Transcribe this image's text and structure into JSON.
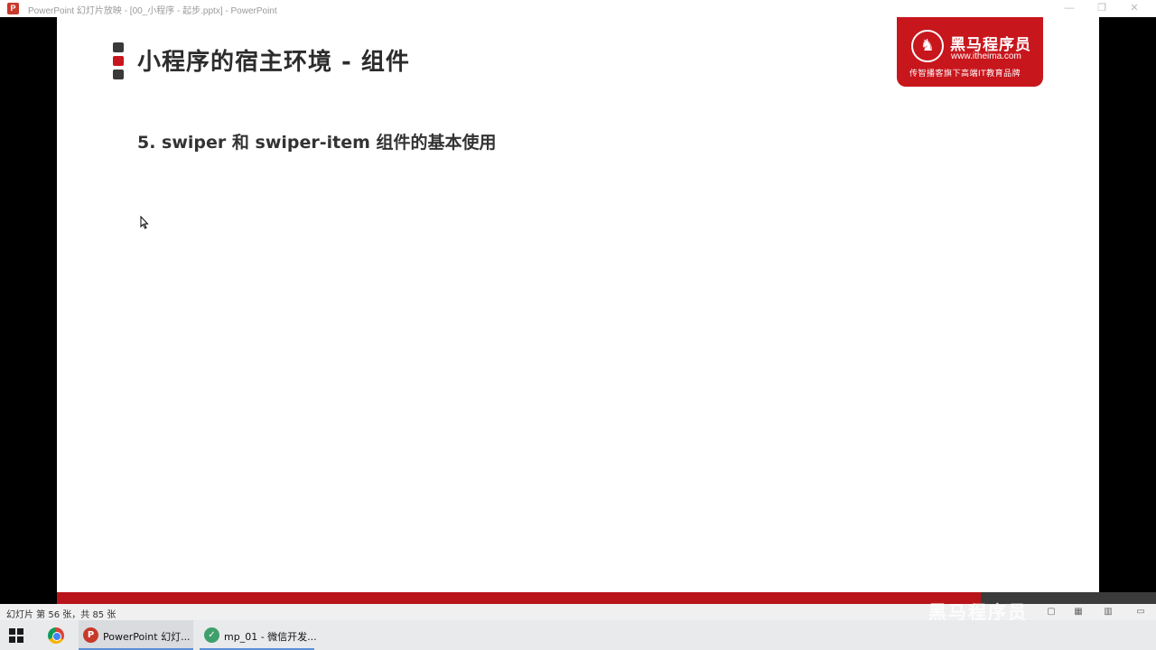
{
  "window": {
    "title": "PowerPoint 幻灯片放映 - [00_小程序 - 起步.pptx] - PowerPoint",
    "minimize": "—",
    "restore": "❐",
    "close": "✕"
  },
  "slide": {
    "title": "小程序的宿主环境 - 组件",
    "subtitle": "5. swiper 和 swiper-item 组件的基本使用",
    "logo": {
      "name": "黑马程序员",
      "url": "www.itheima.com",
      "slogan": "传智播客旗下高端IT教育品牌"
    }
  },
  "statusbar": {
    "slide_info": "幻灯片 第 56 张，共 85 张"
  },
  "watermark": "黑马程序员",
  "taskbar": {
    "items": [
      {
        "label": "PowerPoint 幻灯..."
      },
      {
        "label": "mp_01 - 微信开发..."
      }
    ]
  },
  "colors": {
    "accent_red": "#c8161d",
    "band_red": "#b8141a"
  }
}
